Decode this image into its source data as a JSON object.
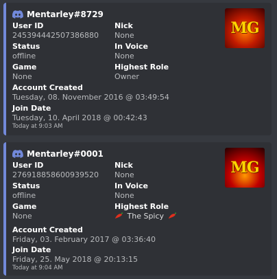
{
  "embeds": [
    {
      "author": "Mentarley#8729",
      "thumbnail_text": "MG",
      "fields": {
        "user_id": {
          "label": "User ID",
          "value": "245394442507386880"
        },
        "nick": {
          "label": "Nick",
          "value": "None"
        },
        "status": {
          "label": "Status",
          "value": "offline"
        },
        "in_voice": {
          "label": "In Voice",
          "value": "None"
        },
        "game": {
          "label": "Game",
          "value": "None"
        },
        "highest_role": {
          "label": "Highest Role",
          "value": "Owner"
        },
        "account_created": {
          "label": "Account Created",
          "value": "Tuesday, 08. November 2016 @ 03:49:54"
        },
        "join_date": {
          "label": "Join Date",
          "value": "Tuesday, 10. April 2018 @ 00:42:43"
        }
      },
      "footer": "Today at 9:03 AM"
    },
    {
      "author": "Mentarley#0001",
      "thumbnail_text": "MG",
      "fields": {
        "user_id": {
          "label": "User ID",
          "value": "276918858600939520"
        },
        "nick": {
          "label": "Nick",
          "value": "None"
        },
        "status": {
          "label": "Status",
          "value": "offline"
        },
        "in_voice": {
          "label": "In Voice",
          "value": "None"
        },
        "game": {
          "label": "Game",
          "value": "None"
        },
        "highest_role": {
          "label": "Highest Role",
          "value": "The Spicy"
        },
        "account_created": {
          "label": "Account Created",
          "value": "Friday, 03. February 2017 @ 03:36:40"
        },
        "join_date": {
          "label": "Join Date",
          "value": "Friday, 25. May 2018 @ 20:13:15"
        }
      },
      "footer": "Today at 9:04 AM"
    }
  ],
  "colors": {
    "background": "#36393f",
    "embed_background": "#2f3136",
    "embed_border": "#7289da",
    "label": "#ffffff",
    "value": "#b9bbbe"
  },
  "icons": {
    "author_icon": "discord-icon",
    "role_icon": "chili-pepper-icon"
  }
}
